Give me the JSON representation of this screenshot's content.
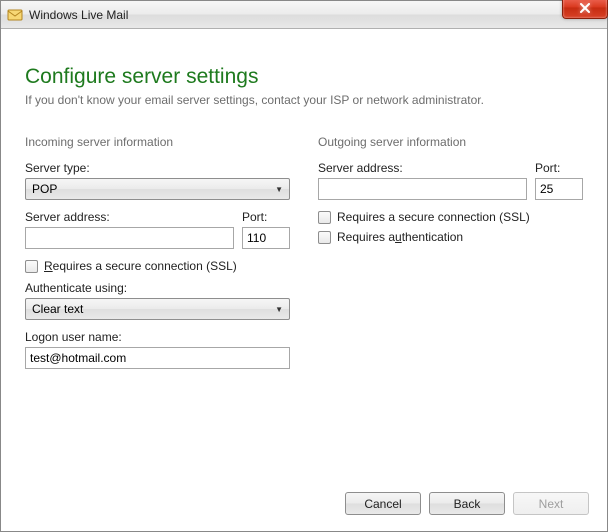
{
  "window": {
    "title": "Windows Live Mail"
  },
  "header": {
    "heading": "Configure server settings",
    "subheading": "If you don't know your email server settings, contact your ISP or network administrator."
  },
  "incoming": {
    "section_title": "Incoming server information",
    "server_type_label": "Server type:",
    "server_type_value": "POP",
    "server_address_label": "Server address:",
    "server_address_value": "",
    "port_label": "Port:",
    "port_value": "110",
    "ssl_text_pre": "",
    "ssl_underline": "R",
    "ssl_text_post": "equires a secure connection (SSL)",
    "auth_label": "Authenticate using:",
    "auth_value": "Clear text",
    "logon_label": "Logon user name:",
    "logon_value": "test@hotmail.com"
  },
  "outgoing": {
    "section_title": "Outgoing server information",
    "server_address_label": "Server address:",
    "server_address_value": "",
    "port_label": "Port:",
    "port_value": "25",
    "ssl_text": "Requires a secure connection (SSL)",
    "auth_text_pre": "Requires a",
    "auth_underline": "u",
    "auth_text_post": "thentication"
  },
  "footer": {
    "cancel": "Cancel",
    "back": "Back",
    "next": "Next"
  }
}
